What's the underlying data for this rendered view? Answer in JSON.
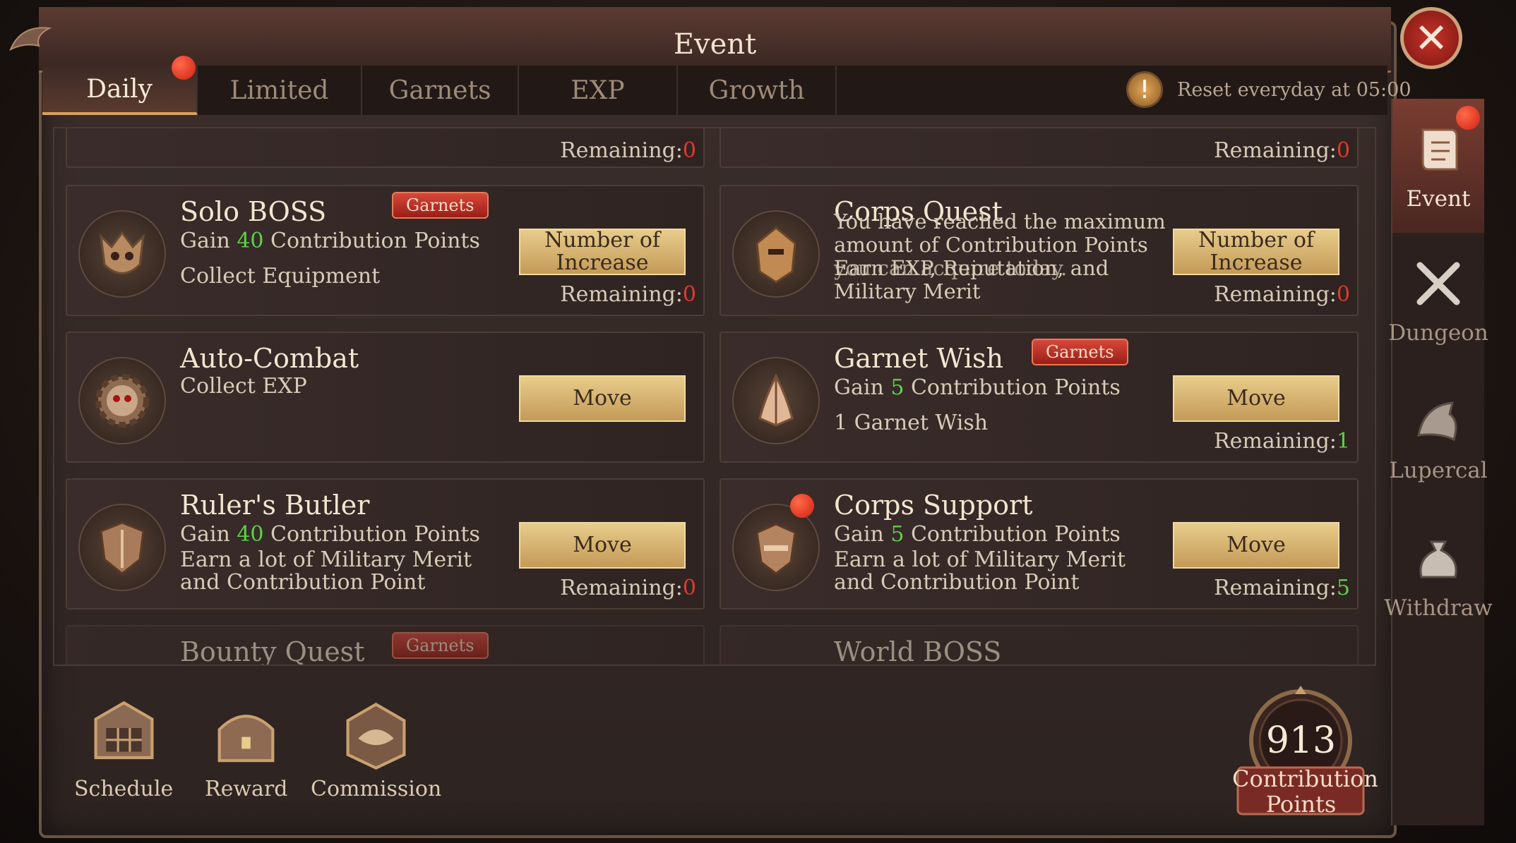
{
  "header": {
    "title": "Event",
    "close_symbol": "✕"
  },
  "tabs": [
    {
      "label": "Daily",
      "active": true
    },
    {
      "label": "Limited"
    },
    {
      "label": "Garnets"
    },
    {
      "label": "EXP"
    },
    {
      "label": "Growth"
    }
  ],
  "reset_notice": {
    "icon": "!",
    "text": "Reset everyday at 05:00"
  },
  "cards": {
    "top_left_remaining_label": "Remaining:",
    "top_left_remaining_value": "0",
    "top_right_remaining_label": "Remaining:",
    "top_right_remaining_value": "0",
    "solo_boss": {
      "name": "Solo BOSS",
      "badge": "Garnets",
      "gain_prefix": "Gain ",
      "gain_value": "40",
      "gain_suffix": " Contribution Points",
      "desc": "Collect Equipment",
      "button": "Number of Increase",
      "remaining_label": "Remaining:",
      "remaining_value": "0"
    },
    "corps_quest": {
      "name": "Corps Quest",
      "overlay_1": "You have reached the maximum",
      "overlay_2": "amount of Contribution Points",
      "overlay_3": "you can acquire today.",
      "desc_3": "Earn EXP, Reputation, and",
      "desc_4": "Military Merit",
      "button": "Number of Increase",
      "remaining_label": "Remaining:",
      "remaining_value": "0"
    },
    "auto_combat": {
      "name": "Auto-Combat",
      "desc": "Collect EXP",
      "button": "Move"
    },
    "garnet_wish": {
      "name": "Garnet Wish",
      "badge": "Garnets",
      "gain_prefix": "Gain ",
      "gain_value": "5",
      "gain_suffix": " Contribution Points",
      "desc": "1 Garnet Wish",
      "button": "Move",
      "remaining_label": "Remaining:",
      "remaining_value": "1"
    },
    "rulers_butler": {
      "name": "Ruler's Butler",
      "gain_prefix": "Gain ",
      "gain_value": "40",
      "gain_suffix": " Contribution Points",
      "desc_1": "Earn a lot of Military Merit",
      "desc_2": "and Contribution Point",
      "button": "Move",
      "remaining_label": "Remaining:",
      "remaining_value": "0"
    },
    "corps_support": {
      "name": "Corps Support",
      "gain_prefix": "Gain ",
      "gain_value": "5",
      "gain_suffix": " Contribution Points",
      "desc_1": "Earn a lot of Military Merit",
      "desc_2": "and Contribution Point",
      "button": "Move",
      "remaining_label": "Remaining:",
      "remaining_value": "5"
    },
    "bounty_quest": {
      "name": "Bounty Quest",
      "badge": "Garnets"
    },
    "world_boss": {
      "name": "World BOSS"
    }
  },
  "sidebar": [
    {
      "label": "Event",
      "icon": "scroll-icon",
      "active": true
    },
    {
      "label": "Dungeon",
      "icon": "crossed-swords-icon"
    },
    {
      "label": "Lupercal",
      "icon": "wolf-head-icon"
    },
    {
      "label": "Withdraw",
      "icon": "money-bag-icon"
    }
  ],
  "bottom_bar": [
    {
      "label": "Schedule",
      "icon": "calendar-icon"
    },
    {
      "label": "Reward",
      "icon": "treasure-chest-icon"
    },
    {
      "label": "Commission",
      "icon": "handshake-icon"
    }
  ],
  "contribution": {
    "value": "913",
    "label_1": "Contribution",
    "label_2": "Points"
  },
  "colors": {
    "accent_gold": "#d8a15e",
    "alert_red": "#d01f12",
    "green_value": "#5fd04a",
    "button_gold": "#e8cc8b"
  }
}
